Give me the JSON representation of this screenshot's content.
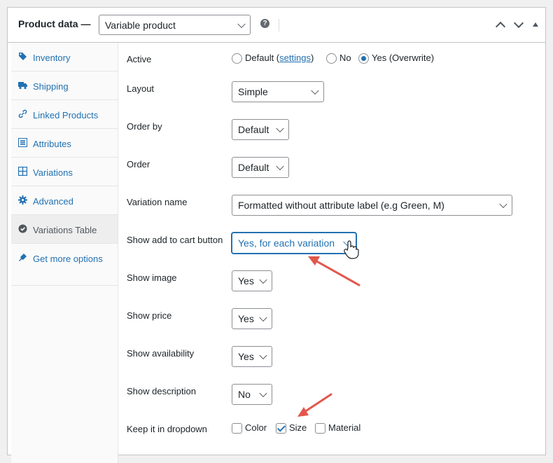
{
  "header": {
    "title": "Product data —",
    "product_type": "Variable product",
    "help_icon": "question-mark-circle-icon",
    "controls": [
      "move-up-icon",
      "move-down-icon",
      "toggle-panel-icon"
    ]
  },
  "sidebar": {
    "items": [
      {
        "label": "Inventory",
        "icon": "tag-icon"
      },
      {
        "label": "Shipping",
        "icon": "truck-icon"
      },
      {
        "label": "Linked Products",
        "icon": "link-icon"
      },
      {
        "label": "Attributes",
        "icon": "list-icon"
      },
      {
        "label": "Variations",
        "icon": "grid-icon"
      },
      {
        "label": "Advanced",
        "icon": "gear-icon"
      },
      {
        "label": "Variations Table",
        "icon": "check-circle-icon",
        "active": true
      },
      {
        "label": "Get more options",
        "icon": "plugin-icon"
      }
    ]
  },
  "form": {
    "active": {
      "label": "Active",
      "options": {
        "default_prefix": "Default (",
        "default_link": "settings",
        "default_suffix": ")",
        "no": "No",
        "yes": "Yes (Overwrite)"
      },
      "selected": "yes"
    },
    "layout": {
      "label": "Layout",
      "value": "Simple"
    },
    "order_by": {
      "label": "Order by",
      "value": "Default"
    },
    "order": {
      "label": "Order",
      "value": "Default"
    },
    "variation_name": {
      "label": "Variation name",
      "value": "Formatted without attribute label (e.g Green, M)"
    },
    "show_add_to_cart": {
      "label": "Show add to cart button",
      "value": "Yes, for each variation"
    },
    "show_image": {
      "label": "Show image",
      "value": "Yes"
    },
    "show_price": {
      "label": "Show price",
      "value": "Yes"
    },
    "show_availability": {
      "label": "Show availability",
      "value": "Yes"
    },
    "show_description": {
      "label": "Show description",
      "value": "No"
    },
    "keep_in_dropdown": {
      "label": "Keep it in dropdown",
      "options": [
        {
          "label": "Color",
          "checked": false
        },
        {
          "label": "Size",
          "checked": true
        },
        {
          "label": "Material",
          "checked": false
        }
      ]
    }
  },
  "colors": {
    "accent": "#2271b1",
    "annotation_arrow": "#e2574c"
  }
}
